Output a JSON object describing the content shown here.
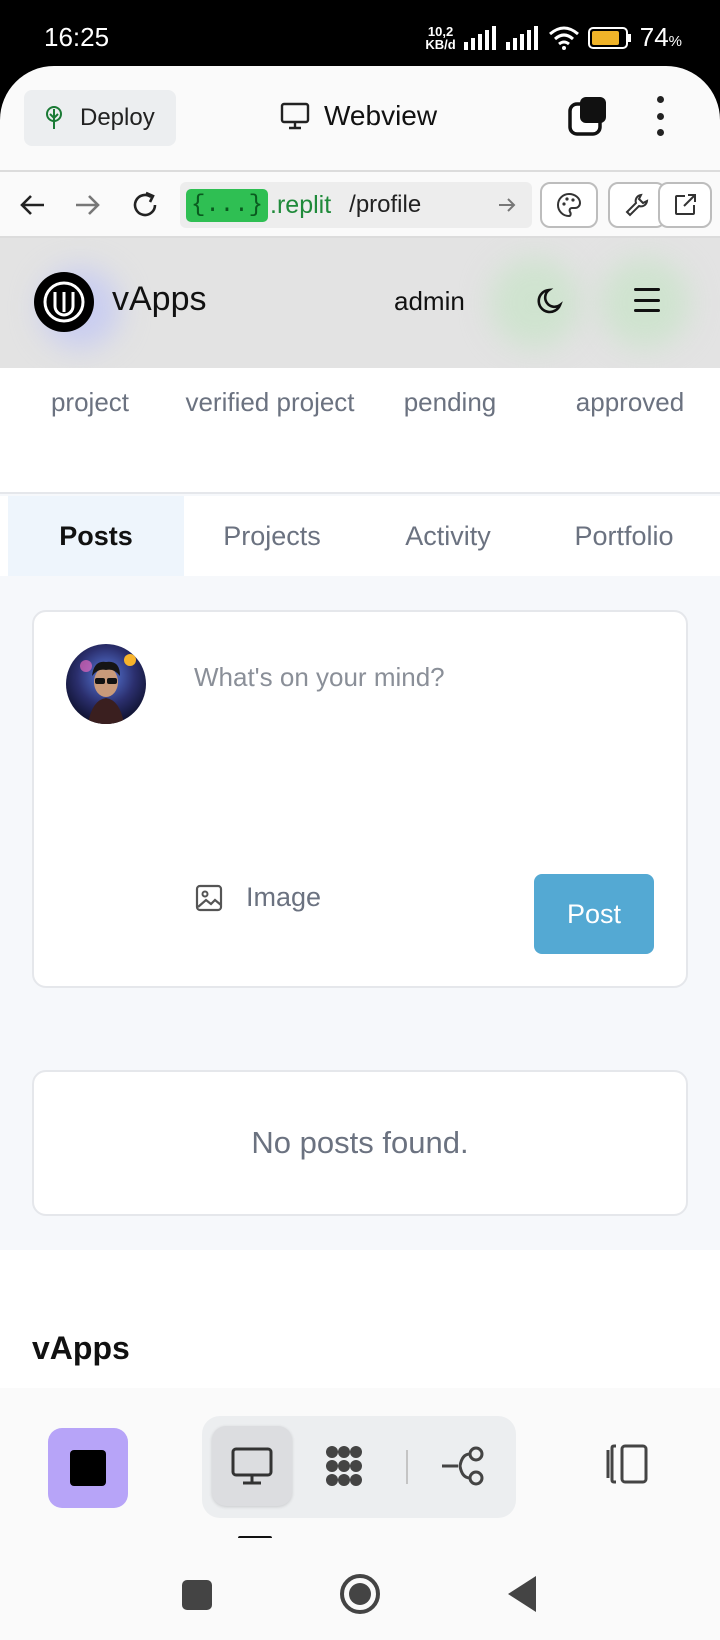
{
  "status_bar": {
    "time": "16:25",
    "speed_value": "10,2",
    "speed_unit": "KB/d",
    "battery_percent": "74",
    "battery_symbol": "%"
  },
  "replit_header": {
    "deploy_label": "Deploy",
    "webview_label": "Webview"
  },
  "url_bar": {
    "badge": "{...}",
    "domain": ".replit",
    "path": "/profile"
  },
  "app": {
    "brand": "vApps",
    "user": "admin",
    "stats": [
      "project",
      "verified project",
      "pending",
      "approved"
    ],
    "tabs": [
      "Posts",
      "Projects",
      "Activity",
      "Portfolio"
    ],
    "active_tab": "Posts",
    "composer": {
      "placeholder": "What's on your mind?",
      "image_label": "Image",
      "post_label": "Post"
    },
    "empty_message": "No posts found.",
    "footer_brand": "vApps"
  },
  "colors": {
    "post_button": "#54a9d3",
    "stop_button": "#b7a4f8",
    "url_badge": "#2fbf53",
    "active_tab_bg": "#eef5fc"
  }
}
